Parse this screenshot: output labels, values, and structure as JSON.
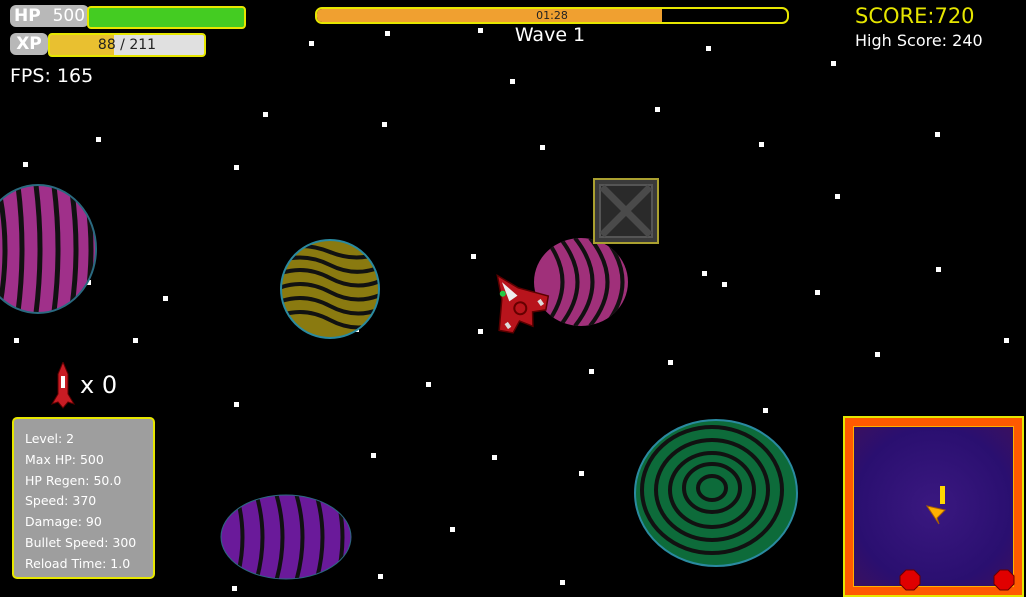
{
  "hud": {
    "hp_label": "HP",
    "hp_value": "500",
    "xp_label": "XP",
    "xp_text": "88 / 211",
    "xp_fraction": 0.417,
    "timer_text": "01:28",
    "timer_fraction": 0.735,
    "wave_text": "Wave 1",
    "score_text": "SCORE:720",
    "high_score_text": "High Score: 240",
    "fps_text": "FPS: 165",
    "missile_count_text": "x 0"
  },
  "stats": [
    "Level: 2",
    "Max HP: 500",
    "HP Regen: 50.0",
    "Speed: 370",
    "Damage: 90",
    "Bullet Speed: 300",
    "Reload Time: 1.0"
  ],
  "colors": {
    "accent_yellow": "#e6e600",
    "hp_green": "#44cc22",
    "xp_gold": "#e9c030",
    "timer_orange": "#f0a030",
    "minimap_border": "#ff5a00",
    "planet_magenta": "#a0308a",
    "planet_olive": "#8a7a10",
    "planet_purple": "#6a1a9a",
    "planet_green": "#0d6b3a"
  },
  "icons": {
    "player_ship": "red-spaceship-icon",
    "missile": "red-missile-icon",
    "crate": "metal-crate-icon"
  }
}
